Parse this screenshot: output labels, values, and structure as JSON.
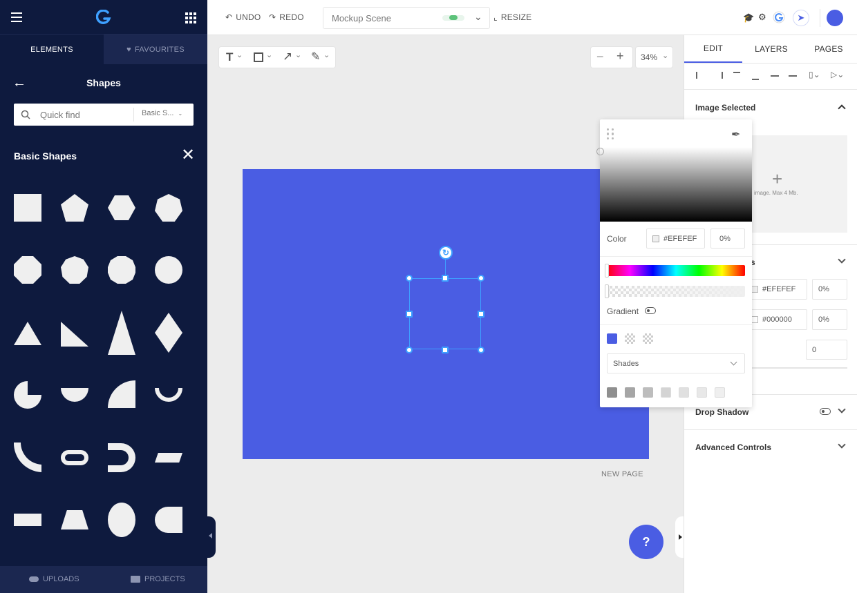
{
  "sidebar": {
    "tabs": {
      "elements": "ELEMENTS",
      "favourites": "FAVOURITES"
    },
    "panel_title": "Shapes",
    "search": {
      "placeholder": "Quick find",
      "category": "Basic S..."
    },
    "section_title": "Basic Shapes",
    "bottom": {
      "uploads": "UPLOADS",
      "projects": "PROJECTS"
    }
  },
  "topbar": {
    "undo": "UNDO",
    "redo": "REDO",
    "scene_name": "Mockup Scene",
    "resize": "RESIZE"
  },
  "canvas_toolbar": {
    "zoom": "34%"
  },
  "canvas": {
    "background_color": "#4a5de3",
    "new_page": "NEW PAGE"
  },
  "help": {
    "label": "?"
  },
  "right_panel": {
    "tabs": [
      "EDIT",
      "LAYERS",
      "PAGES"
    ],
    "image_selected": "Image Selected",
    "upload_hint": "image. Max 4 Mb.",
    "fill_partial": "s",
    "fill_color": "#EFEFEF",
    "fill_opacity": "0%",
    "stroke_color": "#000000",
    "stroke_opacity": "0%",
    "stroke_width": "0",
    "drop_shadow": "Drop Shadow",
    "advanced": "Advanced Controls"
  },
  "color_picker": {
    "color_label": "Color",
    "hex": "#EFEFEF",
    "opacity": "0%",
    "gradient_label": "Gradient",
    "palette_select": "Shades",
    "swatches": [
      "#4a5de3"
    ],
    "shades": [
      "#8f8f8f",
      "#a6a6a6",
      "#bdbdbd",
      "#d4d4d4",
      "#e0e0e0",
      "#e8e8e8",
      "#efefef"
    ]
  }
}
